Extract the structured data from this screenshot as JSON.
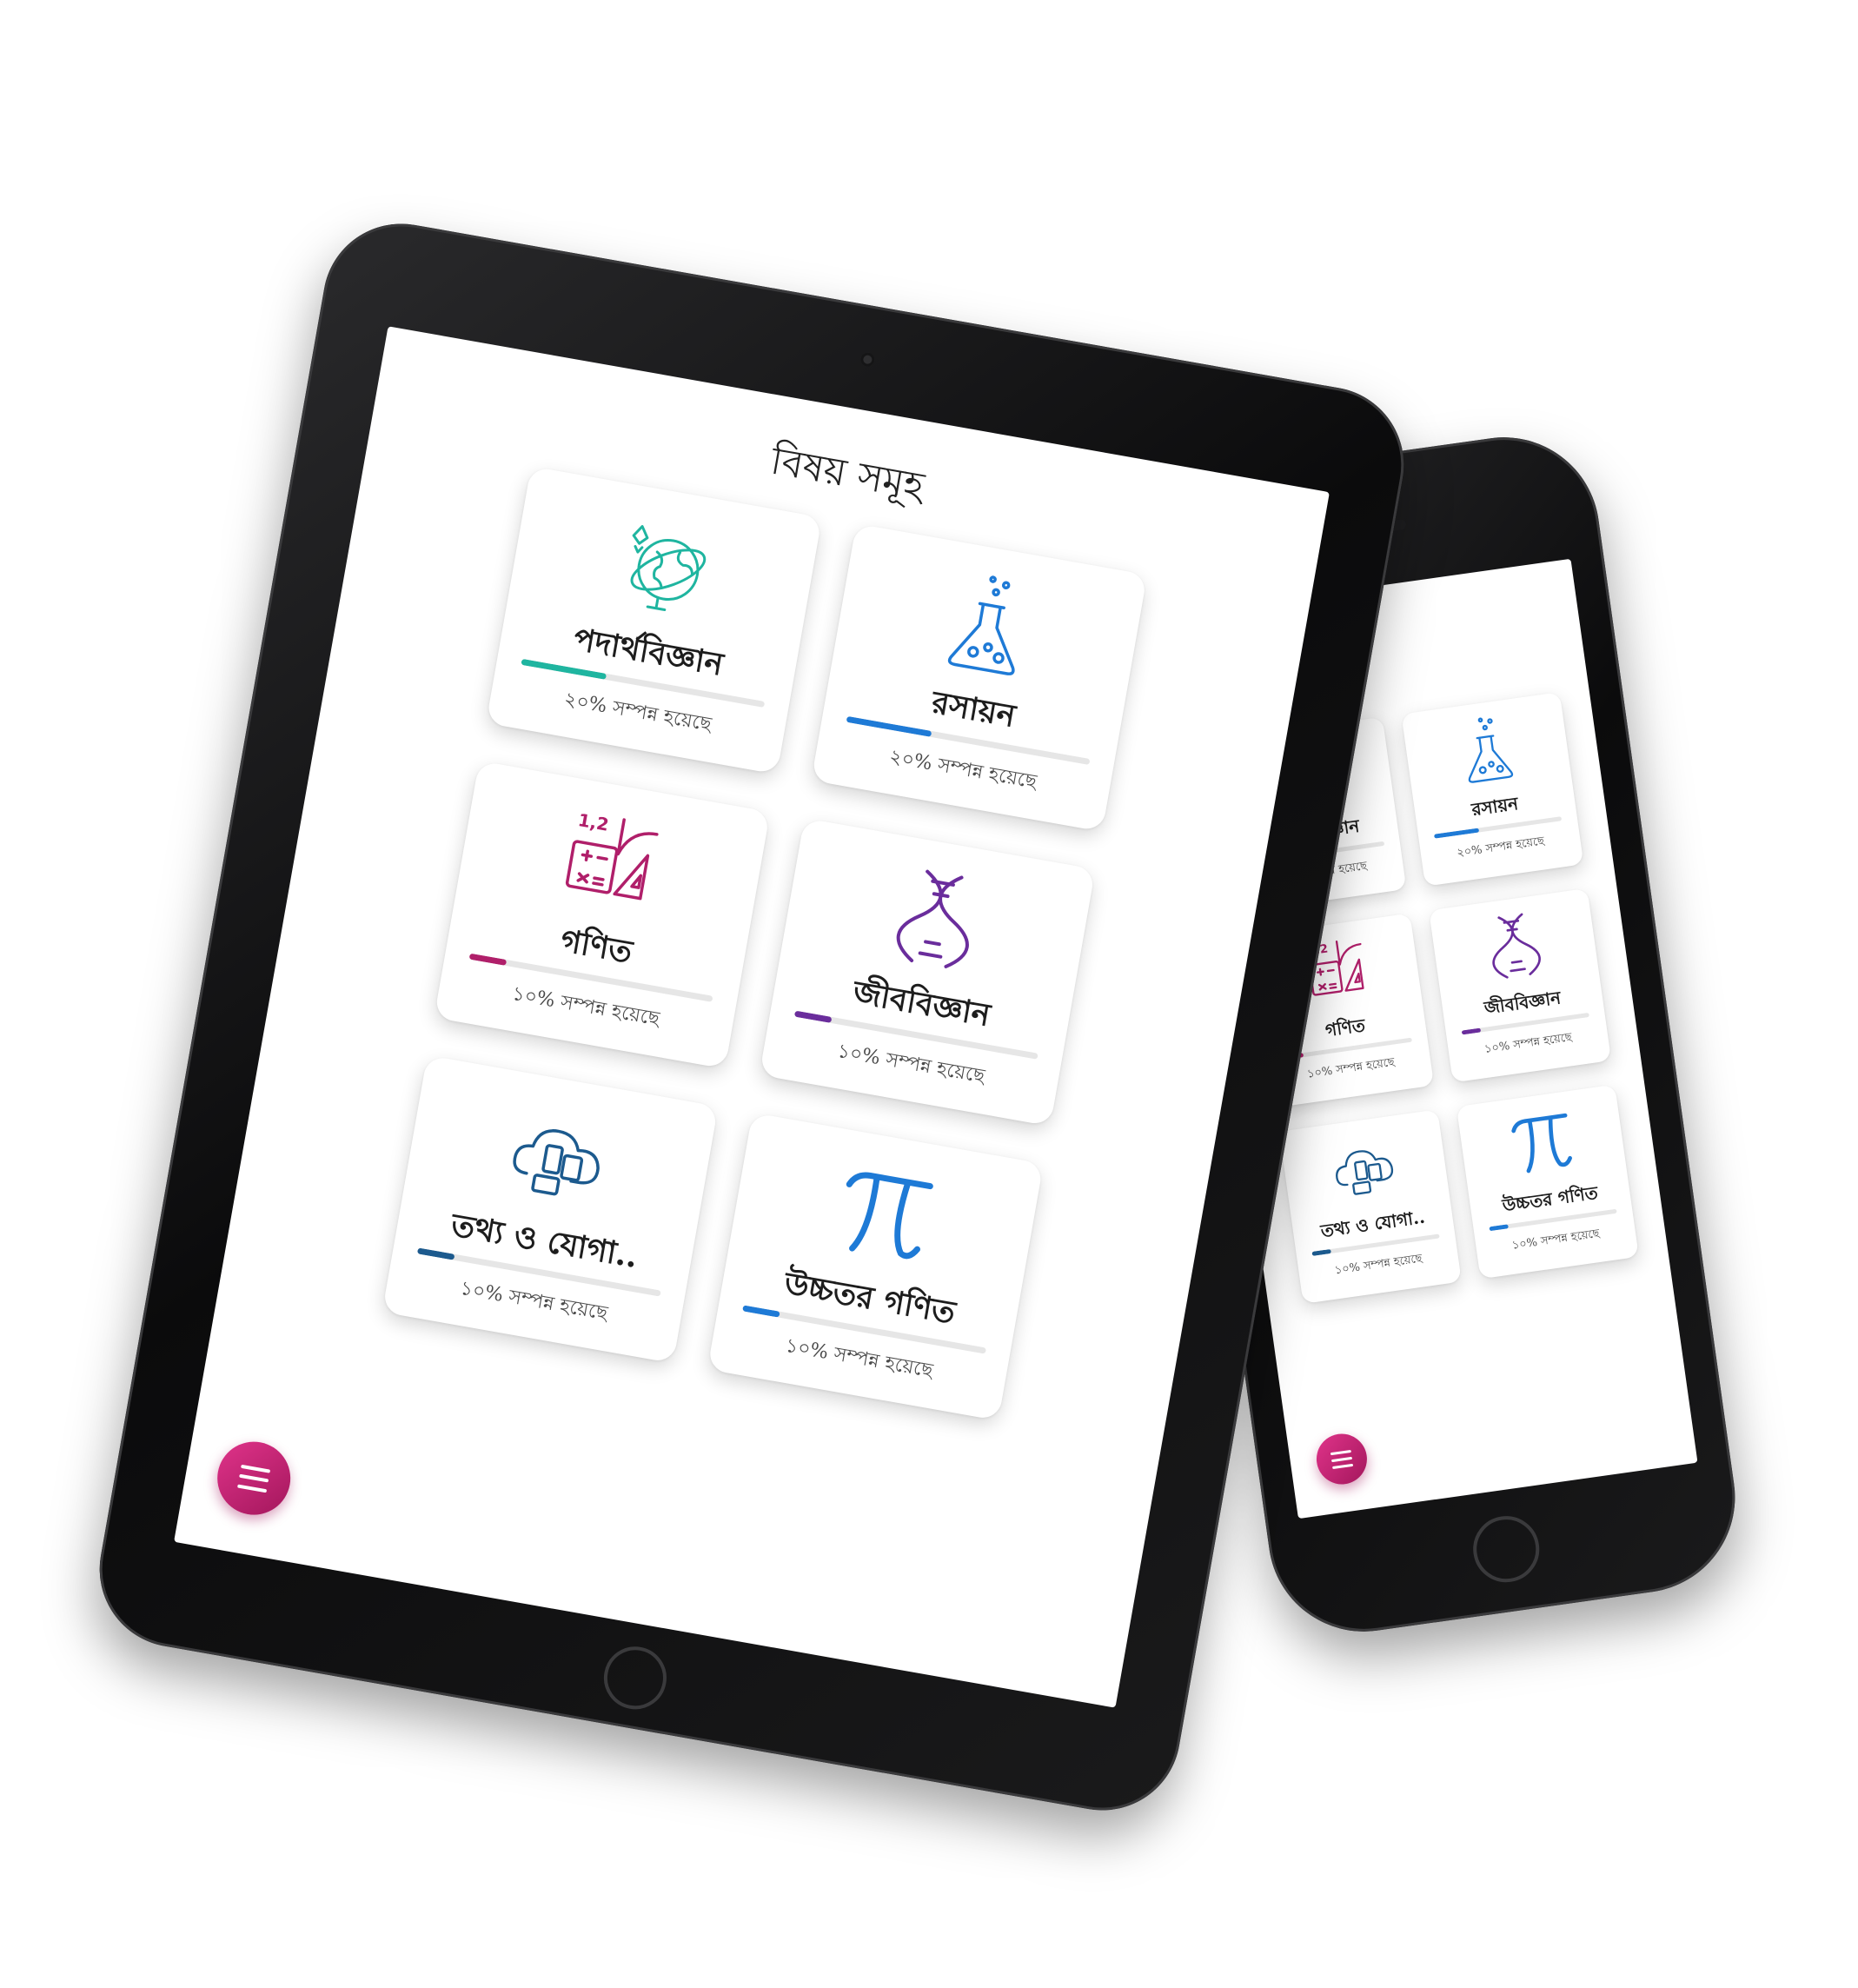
{
  "app": {
    "title": "বিষয় সমূহ"
  },
  "subjects": [
    {
      "name": "পদার্থবিজ্ঞান",
      "status": "২০% সম্পন্ন হয়েছে",
      "progress": 0.35,
      "color": "#1fb5a0",
      "icon": "globe-rocket-icon"
    },
    {
      "name": "রসায়ন",
      "status": "২০% সম্পন্ন হয়েছে",
      "progress": 0.35,
      "color": "#1e7ad6",
      "icon": "flask-icon"
    },
    {
      "name": "গণিত",
      "status": "১০% সম্পন্ন হয়েছে",
      "progress": 0.15,
      "color": "#b01f6a",
      "icon": "calculator-ruler-icon"
    },
    {
      "name": "জীববিজ্ঞান",
      "status": "১০% সম্পন্ন হয়েছে",
      "progress": 0.15,
      "color": "#6a2d9c",
      "icon": "dna-icon"
    },
    {
      "name": "তথ্য ও যোগা..",
      "status": "১০% সম্পন্ন হয়েছে",
      "progress": 0.15,
      "color": "#1c5a8e",
      "icon": "cloud-devices-icon"
    },
    {
      "name": "উচ্চতর গণিত",
      "status": "১০% সম্পন্ন হয়েছে",
      "progress": 0.15,
      "color": "#1e7ad6",
      "icon": "pi-icon"
    }
  ],
  "colors": {
    "fab_start": "#e0338a",
    "fab_end": "#a3175c"
  },
  "menu_button": {
    "icon": "hamburger-menu-icon"
  }
}
